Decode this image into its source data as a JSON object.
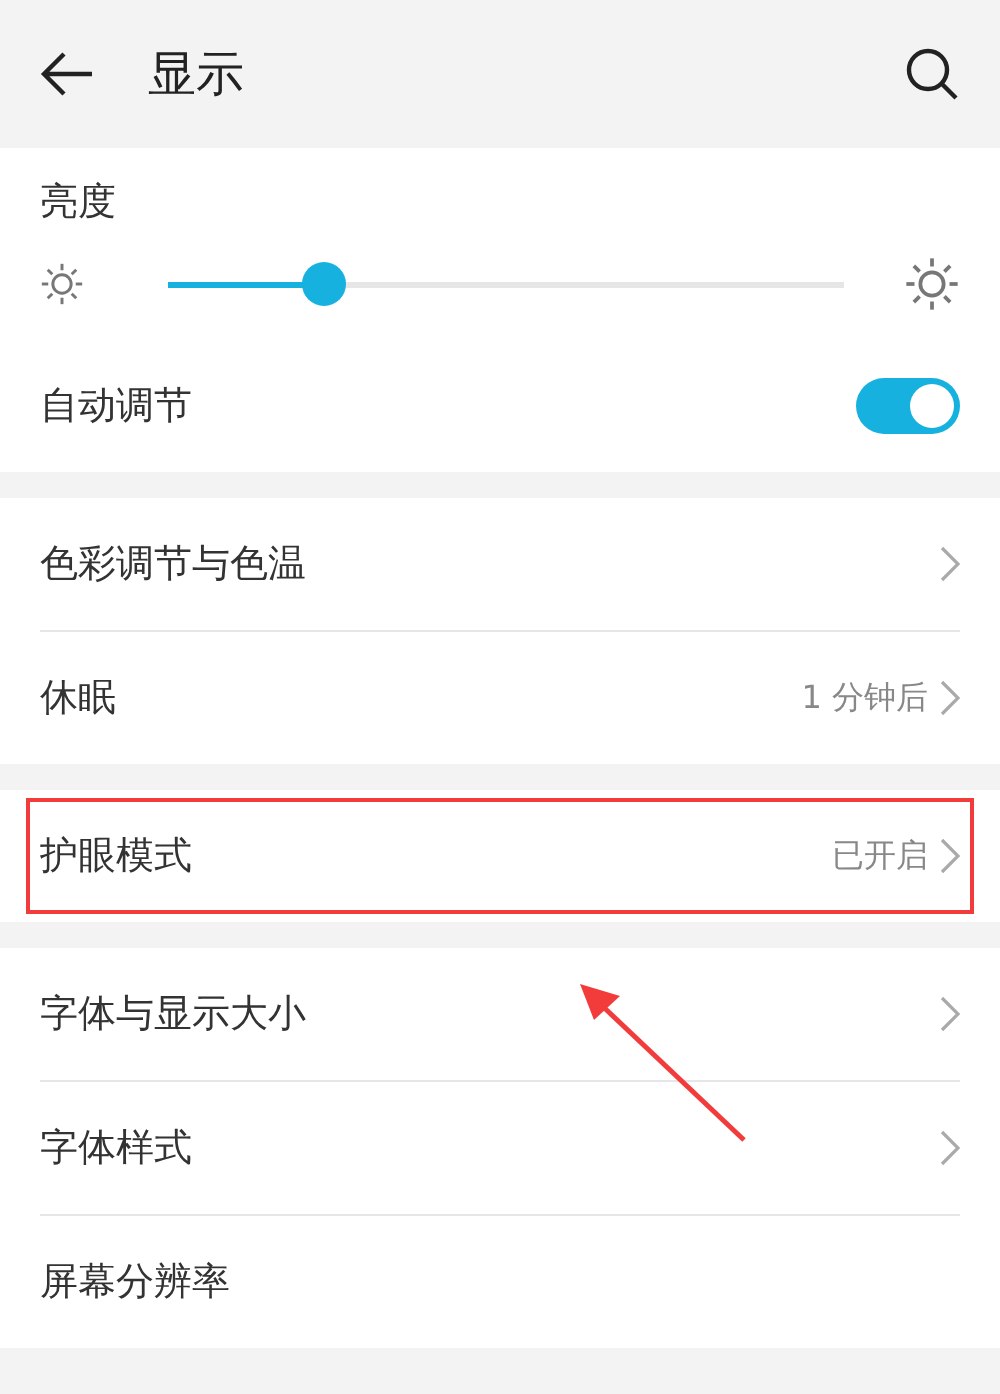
{
  "header": {
    "title": "显示"
  },
  "sections": [
    {
      "items": [
        {
          "kind": "slider",
          "label": "亮度",
          "level": 0.23
        },
        {
          "kind": "toggle",
          "label": "自动调节",
          "on": true
        }
      ]
    },
    {
      "items": [
        {
          "kind": "nav",
          "label": "色彩调节与色温",
          "chevron": true
        },
        {
          "kind": "nav",
          "label": "休眠",
          "value": "1 分钟后",
          "chevron": true
        }
      ]
    },
    {
      "items": [
        {
          "kind": "nav",
          "label": "护眼模式",
          "value": "已开启",
          "chevron": true,
          "highlighted": true
        }
      ]
    },
    {
      "items": [
        {
          "kind": "nav",
          "label": "字体与显示大小",
          "chevron": true
        },
        {
          "kind": "nav",
          "label": "字体样式",
          "chevron": true
        },
        {
          "kind": "nav",
          "label": "屏幕分辨率",
          "chevron": false
        }
      ]
    }
  ],
  "annotation_arrow": true
}
